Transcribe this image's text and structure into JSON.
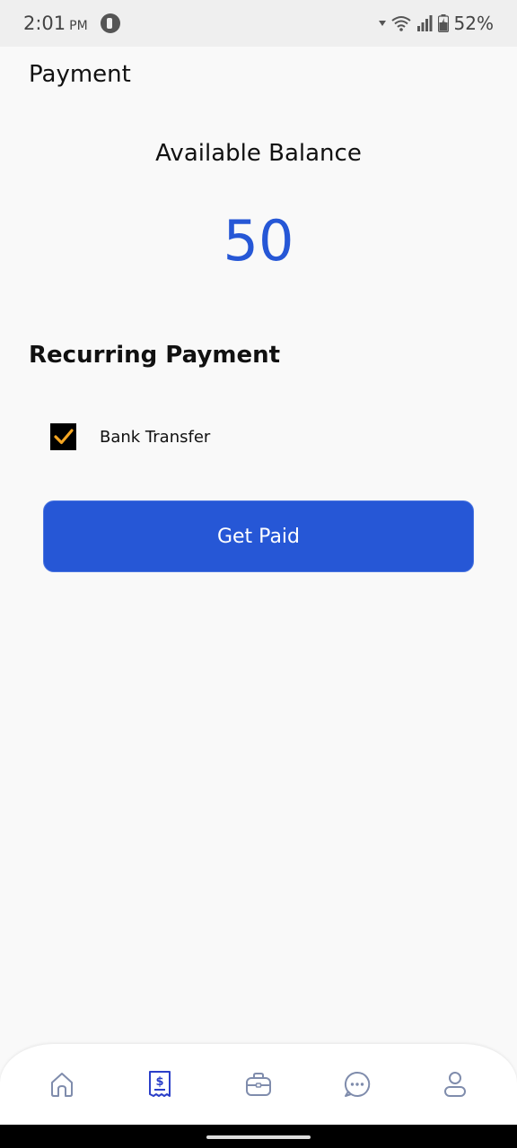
{
  "status_bar": {
    "time": "2:01",
    "ampm": "PM",
    "battery": "52%"
  },
  "page": {
    "title": "Payment"
  },
  "balance": {
    "label": "Available Balance",
    "value": "50"
  },
  "recurring": {
    "title": "Recurring Payment",
    "option_label": "Bank Transfer",
    "checked": true
  },
  "actions": {
    "get_paid_label": "Get Paid"
  },
  "bottom_nav": {
    "items": [
      {
        "icon": "home-icon",
        "active": false
      },
      {
        "icon": "receipt-dollar-icon",
        "active": true
      },
      {
        "icon": "briefcase-icon",
        "active": false
      },
      {
        "icon": "chat-icon",
        "active": false
      },
      {
        "icon": "profile-icon",
        "active": false
      }
    ]
  },
  "colors": {
    "accent": "#2657d6",
    "checkmark": "#f5a623",
    "nav_inactive": "#7f8cac",
    "nav_active": "#2b3fc9"
  }
}
